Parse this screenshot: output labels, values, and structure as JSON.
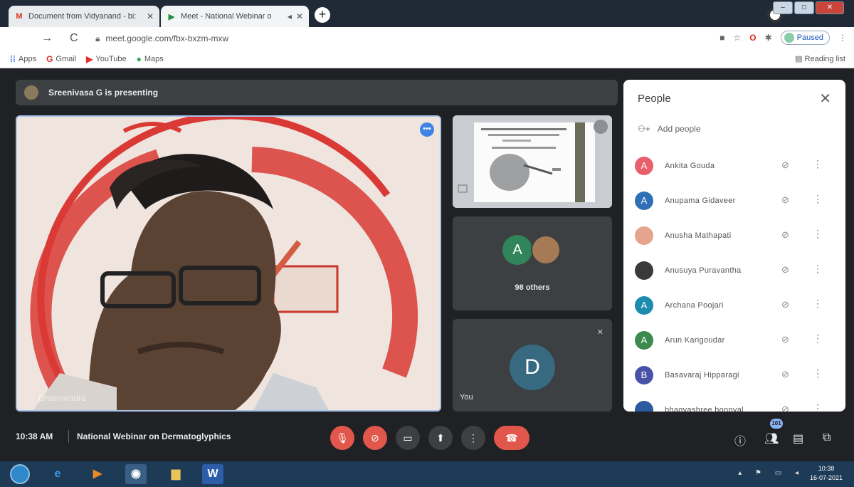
{
  "browser": {
    "tabs": [
      {
        "favicon": "gmail-icon",
        "title": "Document from Vidyanand - bi:"
      },
      {
        "favicon": "meet-icon",
        "title": "Meet - National Webinar o"
      }
    ],
    "address": "meet.google.com/fbx-bxzm-mxw",
    "profile_status": "Paused",
    "bookmarks": [
      "Apps",
      "Gmail",
      "YouTube",
      "Maps"
    ],
    "reading_list": "Reading list"
  },
  "meet": {
    "presenting_banner": "Sreenivasa G is presenting",
    "main_speaker_name": "Dharmendra",
    "thumbnails": {
      "others_avatar_letter": "A",
      "others_label": "98 others",
      "self_avatar_letter": "D",
      "self_label": "You"
    },
    "time": "10:38 AM",
    "meeting_title": "National Webinar on Dermatoglyphics",
    "participant_count": "101"
  },
  "people_panel": {
    "title": "People",
    "add_people": "Add people",
    "participants": [
      {
        "letter": "A",
        "name": "Ankita Gouda",
        "color": "#e8606b"
      },
      {
        "letter": "A",
        "name": "Anupama Gidaveer",
        "color": "#2f6fb5"
      },
      {
        "letter": "",
        "name": "Anusha Mathapati",
        "color": "#e6a38e"
      },
      {
        "letter": "",
        "name": "Anusuya Puravantha",
        "color": "#3a3a3a"
      },
      {
        "letter": "A",
        "name": "Archana Poojari",
        "color": "#1d8bb0"
      },
      {
        "letter": "A",
        "name": "Arun Karigoudar",
        "color": "#3d8a4e"
      },
      {
        "letter": "B",
        "name": "Basavaraj Hipparagi",
        "color": "#4a52a8"
      },
      {
        "letter": "",
        "name": "bhagyashree honnyal",
        "color": "#2c5aa0"
      }
    ]
  },
  "taskbar": {
    "time": "10:38",
    "date": "16-07-2021"
  }
}
